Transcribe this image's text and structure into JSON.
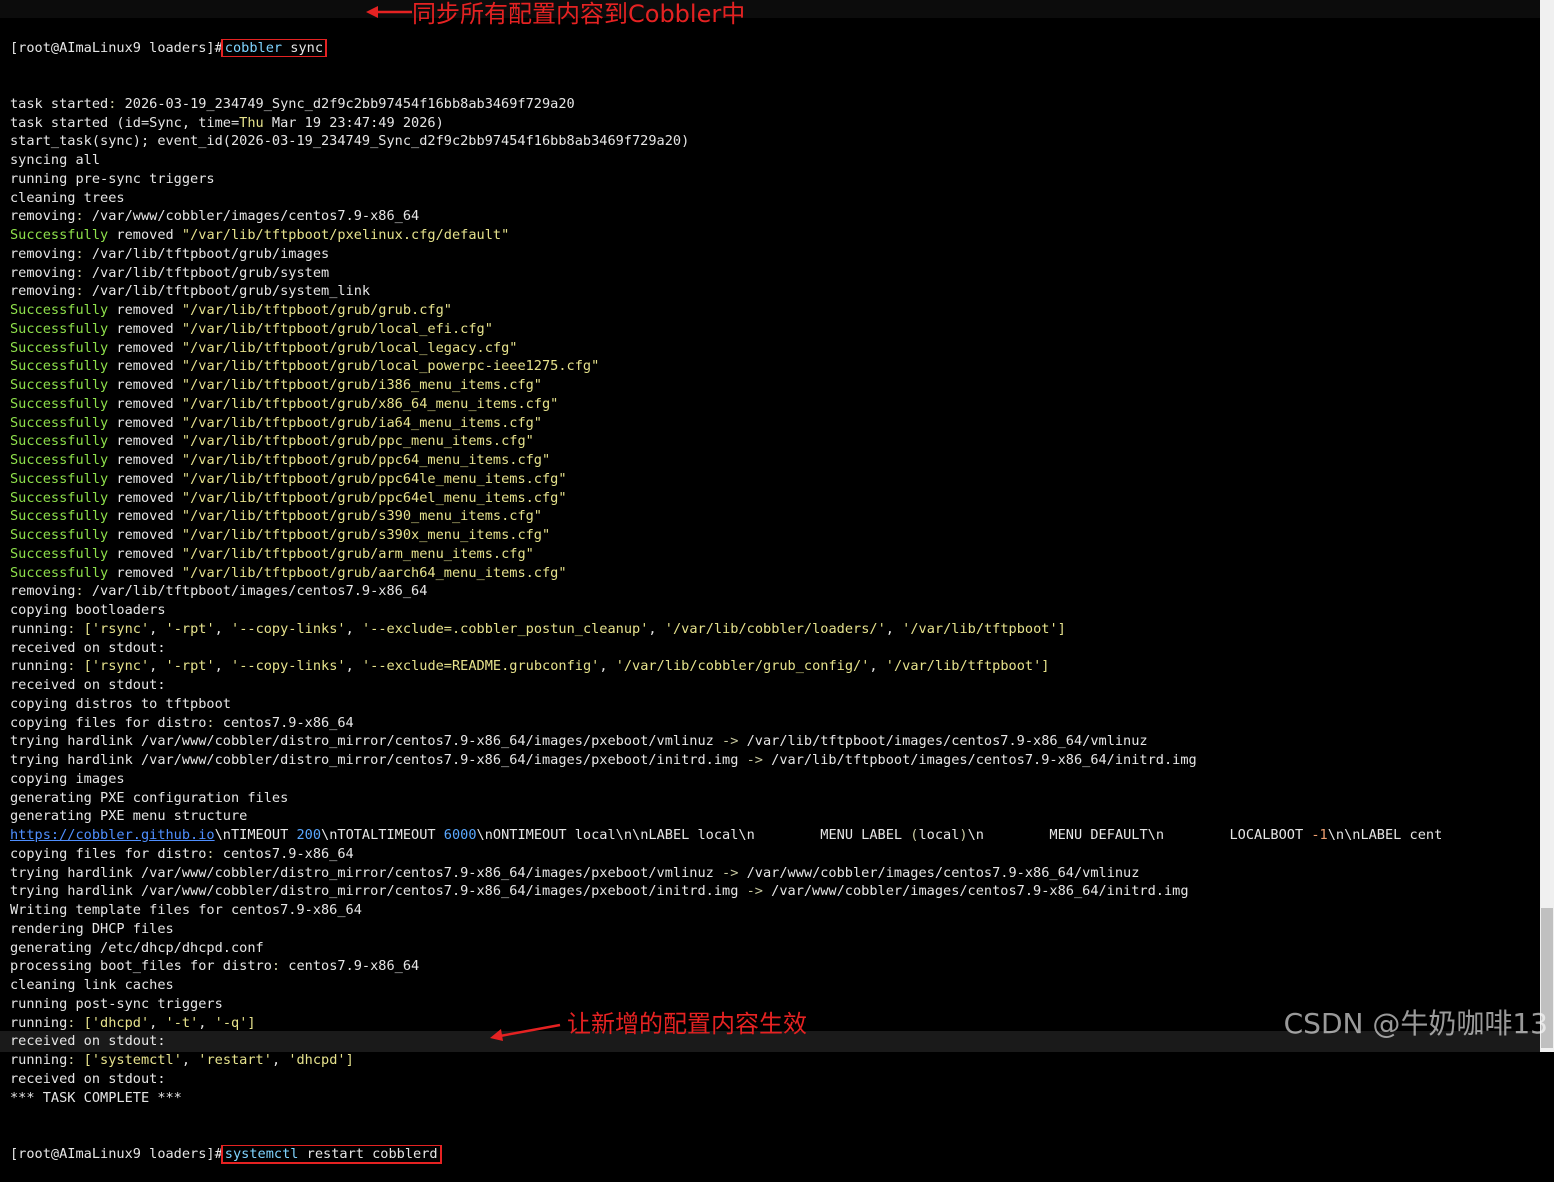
{
  "prompt": {
    "user_host": "[root@AImaLinux9 loaders]",
    "hash": "#",
    "command1_a": "cobbler",
    "command1_b": " sync",
    "command2_a": "systemctl",
    "command2_b": " restart cobblerd"
  },
  "annotations": {
    "top": "同步所有配置内容到Cobbler中",
    "bottom": "让新增的配置内容生效",
    "color": "#e52222"
  },
  "watermark": "CSDN @牛奶咖啡13",
  "colors": {
    "background": "#000000",
    "text": "#e6e6e6",
    "success": "#8ee04b",
    "string": "#e6e28c",
    "link": "#4f8fff"
  },
  "lines": [
    "task started: 2026-03-19_234749_Sync_d2f9c2bb97454f16bb8ab3469f729a20",
    "task started (id=Sync, time=Thu Mar 19 23:47:49 2026)",
    "start_task(sync); event_id(2026-03-19_234749_Sync_d2f9c2bb97454f16bb8ab3469f729a20)",
    "syncing all",
    "running pre-sync triggers",
    "cleaning trees",
    "removing: /var/www/cobbler/images/centos7.9-x86_64",
    "Successfully removed \"/var/lib/tftpboot/pxelinux.cfg/default\"",
    "removing: /var/lib/tftpboot/grub/images",
    "removing: /var/lib/tftpboot/grub/system",
    "removing: /var/lib/tftpboot/grub/system_link",
    "Successfully removed \"/var/lib/tftpboot/grub/grub.cfg\"",
    "Successfully removed \"/var/lib/tftpboot/grub/local_efi.cfg\"",
    "Successfully removed \"/var/lib/tftpboot/grub/local_legacy.cfg\"",
    "Successfully removed \"/var/lib/tftpboot/grub/local_powerpc-ieee1275.cfg\"",
    "Successfully removed \"/var/lib/tftpboot/grub/i386_menu_items.cfg\"",
    "Successfully removed \"/var/lib/tftpboot/grub/x86_64_menu_items.cfg\"",
    "Successfully removed \"/var/lib/tftpboot/grub/ia64_menu_items.cfg\"",
    "Successfully removed \"/var/lib/tftpboot/grub/ppc_menu_items.cfg\"",
    "Successfully removed \"/var/lib/tftpboot/grub/ppc64_menu_items.cfg\"",
    "Successfully removed \"/var/lib/tftpboot/grub/ppc64le_menu_items.cfg\"",
    "Successfully removed \"/var/lib/tftpboot/grub/ppc64el_menu_items.cfg\"",
    "Successfully removed \"/var/lib/tftpboot/grub/s390_menu_items.cfg\"",
    "Successfully removed \"/var/lib/tftpboot/grub/s390x_menu_items.cfg\"",
    "Successfully removed \"/var/lib/tftpboot/grub/arm_menu_items.cfg\"",
    "Successfully removed \"/var/lib/tftpboot/grub/aarch64_menu_items.cfg\"",
    "removing: /var/lib/tftpboot/images/centos7.9-x86_64",
    "copying bootloaders",
    "running: ['rsync', '-rpt', '--copy-links', '--exclude=.cobbler_postun_cleanup', '/var/lib/cobbler/loaders/', '/var/lib/tftpboot']",
    "received on stdout:",
    "running: ['rsync', '-rpt', '--copy-links', '--exclude=README.grubconfig', '/var/lib/cobbler/grub_config/', '/var/lib/tftpboot']",
    "received on stdout:",
    "copying distros to tftpboot",
    "copying files for distro: centos7.9-x86_64",
    "trying hardlink /var/www/cobbler/distro_mirror/centos7.9-x86_64/images/pxeboot/vmlinuz -> /var/lib/tftpboot/images/centos7.9-x86_64/vmlinuz",
    "trying hardlink /var/www/cobbler/distro_mirror/centos7.9-x86_64/images/pxeboot/initrd.img -> /var/lib/tftpboot/images/centos7.9-x86_64/initrd.img",
    "copying images",
    "generating PXE configuration files",
    "generating PXE menu structure",
    "https://cobbler.github.io\\nTIMEOUT 200\\nTOTALTIMEOUT 6000\\nONTIMEOUT local\\n\\nLABEL local\\n        MENU LABEL (local)\\n        MENU DEFAULT\\n        LOCALBOOT -1\\n\\nLABEL cent",
    "copying files for distro: centos7.9-x86_64",
    "trying hardlink /var/www/cobbler/distro_mirror/centos7.9-x86_64/images/pxeboot/vmlinuz -> /var/www/cobbler/images/centos7.9-x86_64/vmlinuz",
    "trying hardlink /var/www/cobbler/distro_mirror/centos7.9-x86_64/images/pxeboot/initrd.img -> /var/www/cobbler/images/centos7.9-x86_64/initrd.img",
    "Writing template files for centos7.9-x86_64",
    "rendering DHCP files",
    "generating /etc/dhcp/dhcpd.conf",
    "processing boot_files for distro: centos7.9-x86_64",
    "cleaning link caches",
    "running post-sync triggers",
    "running: ['dhcpd', '-t', '-q']",
    "received on stdout:",
    "running: ['systemctl', 'restart', 'dhcpd']",
    "received on stdout:",
    "*** TASK COMPLETE ***"
  ]
}
